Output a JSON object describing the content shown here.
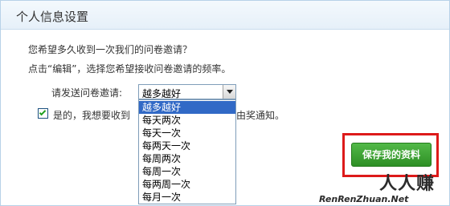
{
  "header": {
    "title": "个人信息设置"
  },
  "intro": {
    "question": "您希望多久收到一次我们的问卷邀请？",
    "hint": "点击“编辑”，选择您希望接收问卷邀请的频率。"
  },
  "frequency": {
    "label": "请发送问卷邀请:",
    "selected": "越多越好",
    "options": [
      "越多越好",
      "每天两次",
      "每天一次",
      "每两天一次",
      "每周两次",
      "每周一次",
      "每两周一次",
      "每月一次"
    ]
  },
  "notify": {
    "checked": true,
    "text_before": "是的，我想要收到",
    "text_after": "由奖通知。"
  },
  "actions": {
    "save_label": "保存我的资料"
  },
  "watermark": {
    "logo_text": "人人赚",
    "url": "RenRenZhuan.Net"
  },
  "colors": {
    "accent_red": "#dd1a1a",
    "button_green": "#3ea233",
    "selection_blue": "#3169c6"
  }
}
